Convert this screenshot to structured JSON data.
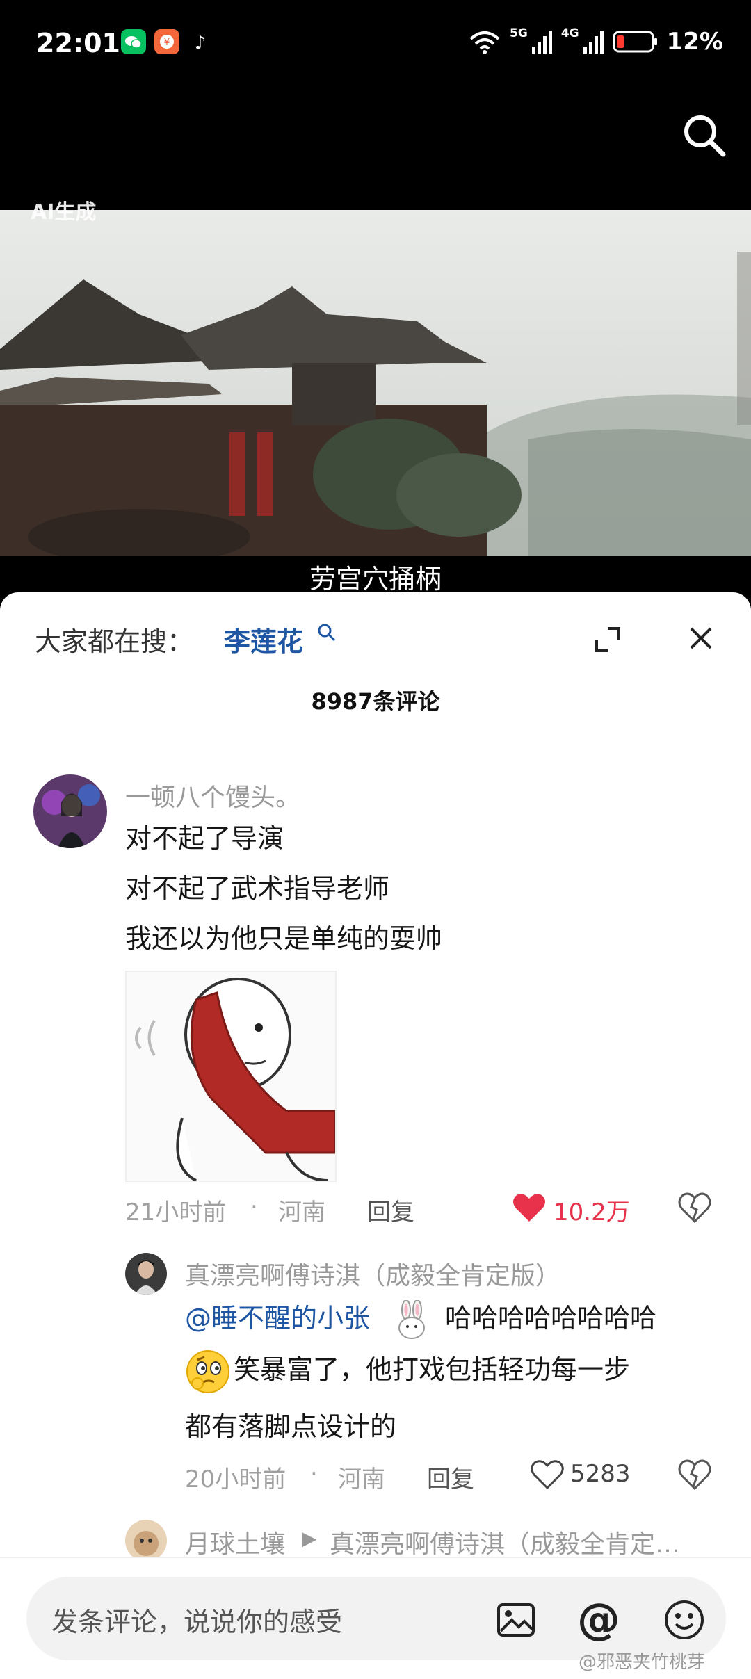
{
  "status_bar": {
    "time": "22:01",
    "battery": "12%",
    "network1": "5G",
    "network2": "4G",
    "app_icons": [
      "wechat-icon",
      "taobao-icon",
      "douyin-icon"
    ]
  },
  "video": {
    "ai_label": "AI生成",
    "subtitle": "劳宫穴捅柄"
  },
  "sheet": {
    "search_prefix": "大家都在搜：",
    "search_term": "李莲花",
    "comment_count": "8987条评论"
  },
  "comments": [
    {
      "user": "一顿八个馒头。",
      "lines": [
        "对不起了导演",
        "对不起了武术指导老师",
        "我还以为他只是单纯的耍帅"
      ],
      "time": "21小时前",
      "location": "河南",
      "reply_label": "回复",
      "likes": "10.2万",
      "liked": true,
      "replies": [
        {
          "user": "真漂亮啊傅诗淇（成毅全肯定版）",
          "mention": "@睡不醒的小张",
          "line1_rest": "哈哈哈哈哈哈哈哈",
          "line2": "笑暴富了，他打戏包括轻功每一步",
          "line3": "都有落脚点设计的",
          "time": "20小时前",
          "location": "河南",
          "reply_label": "回复",
          "likes": "5283"
        },
        {
          "user": "月球土壤",
          "arrow": "▶",
          "reply_to": "真漂亮啊傅诗淇（成毅全肯定…"
        }
      ]
    }
  ],
  "input": {
    "placeholder": "发条评论，说说你的感受"
  },
  "watermark": "@邪恶夹竹桃芽",
  "colors": {
    "link": "#1f56a4",
    "like_red": "#e8314a",
    "sheet_bg": "#ffffff"
  }
}
